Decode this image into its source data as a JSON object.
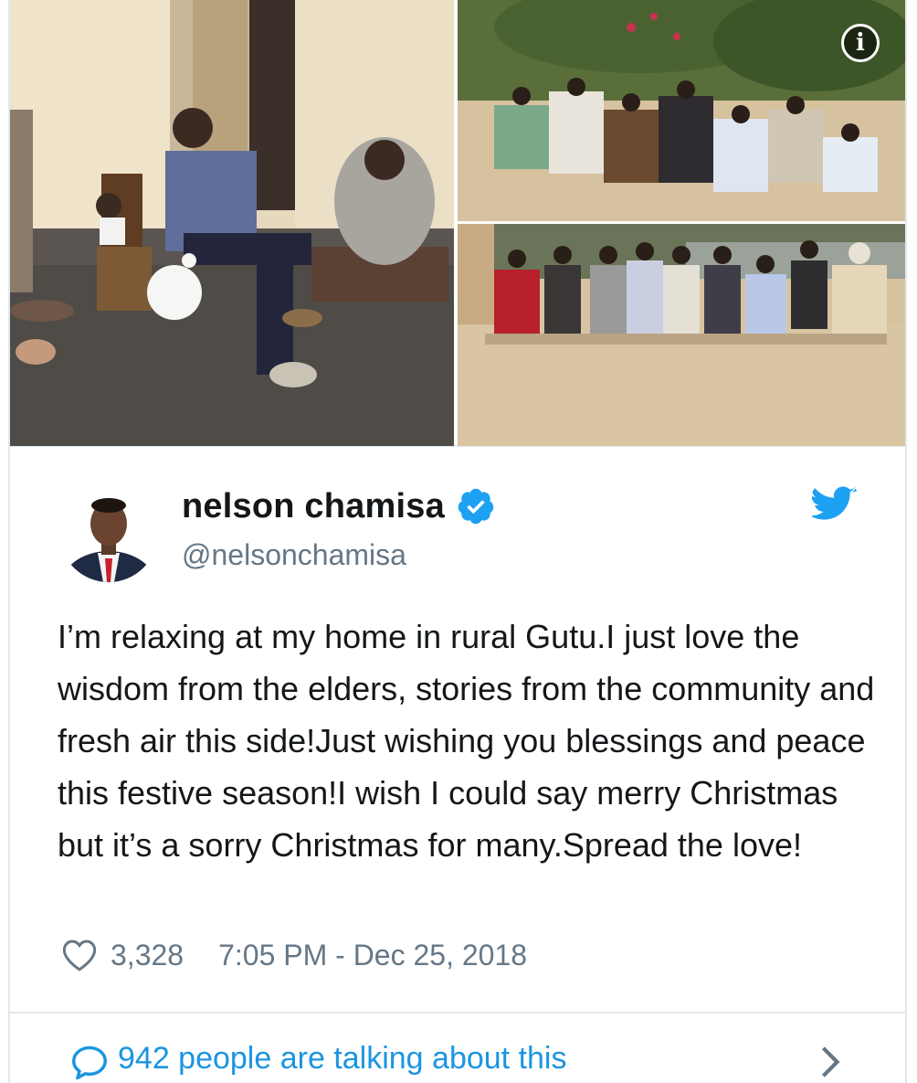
{
  "media": {
    "info_icon": "info-icon"
  },
  "author": {
    "display_name": "nelson chamisa",
    "handle": "@nelsonchamisa",
    "verified_icon": "verified-badge-icon",
    "platform_icon": "twitter-bird-icon"
  },
  "tweet": {
    "text": "I’m relaxing at my home in rural Gutu.I just love the wisdom from the elders, stories from the community and fresh air this side!Just wishing you blessings and peace this festive season!I wish I could say merry Christmas but it’s a sorry Christmas for many.Spread the love!",
    "likes": "3,328",
    "timestamp": "7:05 PM - Dec 25, 2018"
  },
  "footer": {
    "talking_label": "942 people are talking about this",
    "comment_icon": "comment-icon",
    "chevron_icon": "chevron-right-icon"
  },
  "colors": {
    "accent": "#1da1f2",
    "link": "#1b95e0",
    "muted": "#657786",
    "border": "#e1e8ed"
  }
}
